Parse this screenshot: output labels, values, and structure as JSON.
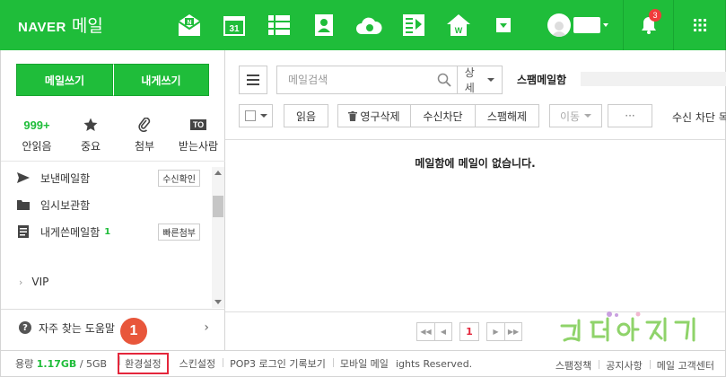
{
  "header": {
    "brand": "NAVER",
    "app_name": "메일",
    "notification_count": "3",
    "apps": [
      "mail-home-icon",
      "calendar-icon",
      "contacts-list-icon",
      "address-book-icon",
      "cloud-icon",
      "memo-icon",
      "home-icon",
      "more-apps-icon"
    ],
    "calendar_day": "31"
  },
  "sidebar": {
    "write_mail": "메일쓰기",
    "write_to_me": "내게쓰기",
    "quick": [
      {
        "top": "999+",
        "label": "안읽음"
      },
      {
        "top": "",
        "label": "중요"
      },
      {
        "top": "",
        "label": "첨부"
      },
      {
        "top": "TO",
        "label": "받는사람"
      }
    ],
    "folders": [
      {
        "name": "보낸메일함",
        "tag": "수신확인",
        "count": ""
      },
      {
        "name": "임시보관함",
        "tag": "",
        "count": ""
      },
      {
        "name": "내게쓴메일함",
        "tag": "빠른첨부",
        "count": "1"
      }
    ],
    "vip": "VIP",
    "help": "자주 찾는 도움말"
  },
  "main": {
    "search_placeholder": "메일검색",
    "detail_label": "상세",
    "folder_title": "스팸메일함",
    "toolbar": {
      "read": "읽음",
      "delete_forever": "영구삭제",
      "block": "수신차단",
      "unspam": "스팸해제",
      "move": "이동",
      "more": "···",
      "right_text": "수신 차단 목록"
    },
    "empty_message": "메일함에 메일이 없습니다.",
    "pagination": {
      "current": "1"
    },
    "watermark": "컴테아지기"
  },
  "footer": {
    "capacity_label": "용량",
    "capacity_used": "1.17GB",
    "capacity_total": "/ 5GB",
    "settings": "환경설정",
    "skin": "스킨설정",
    "pop3": "POP3 로그인 기록보기",
    "mobile": "모바일 메일",
    "rights": "ights Reserved.",
    "spam_policy": "스팸정책",
    "notice": "공지사항",
    "support": "메일 고객센터"
  },
  "annotation": {
    "marker": "1"
  },
  "colors": {
    "brand_green": "#1fbd3a",
    "highlight_red": "#e4263b",
    "marker_orange": "#e8563b"
  }
}
